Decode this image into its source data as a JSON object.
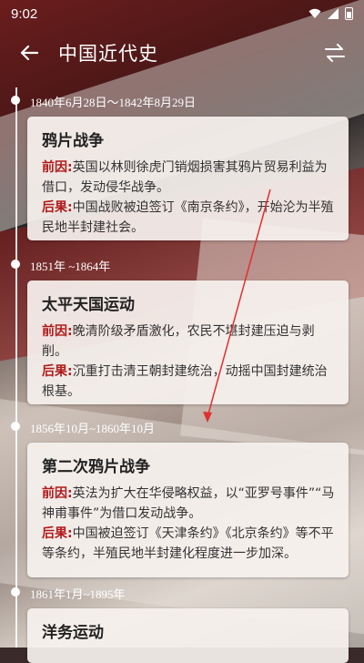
{
  "status": {
    "time": "9:02"
  },
  "header": {
    "title": "中国近代史"
  },
  "timeline": [
    {
      "date": "1840年6月28日～1842年8月29日",
      "title": "鸦片战争",
      "cause_label": "前因:",
      "cause": "英国以林则徐虎门销烟损害其鸦片贸易利益为借口，发动侵华战争。",
      "effect_label": "后果:",
      "effect": "中国战败被迫签订《南京条约》，开始沦为半殖民地半封建社会。"
    },
    {
      "date": "1851年 ~1864年",
      "title": "太平天国运动",
      "cause_label": "前因:",
      "cause": "晚清阶级矛盾激化，农民不堪封建压迫与剥削。",
      "effect_label": "后果:",
      "effect": "沉重打击清王朝封建统治，动摇中国封建统治根基。"
    },
    {
      "date": "1856年10月~1860年10月",
      "title": "第二次鸦片战争",
      "cause_label": "前因:",
      "cause": "英法为扩大在华侵略权益，以“亚罗号事件”“马神甫事件”为借口发动战争。",
      "effect_label": "后果:",
      "effect": "中国被迫签订《天津条约》《北京条约》等不平等条约，半殖民地半封建化程度进一步加深。"
    },
    {
      "date": "1861年1月~1895年",
      "title": "洋务运动"
    }
  ],
  "colors": {
    "accent": "#b01a1a",
    "card": "#f6f1ee"
  },
  "icons": {
    "back": "arrow-left-icon",
    "switch": "swap-arrows-icon"
  }
}
